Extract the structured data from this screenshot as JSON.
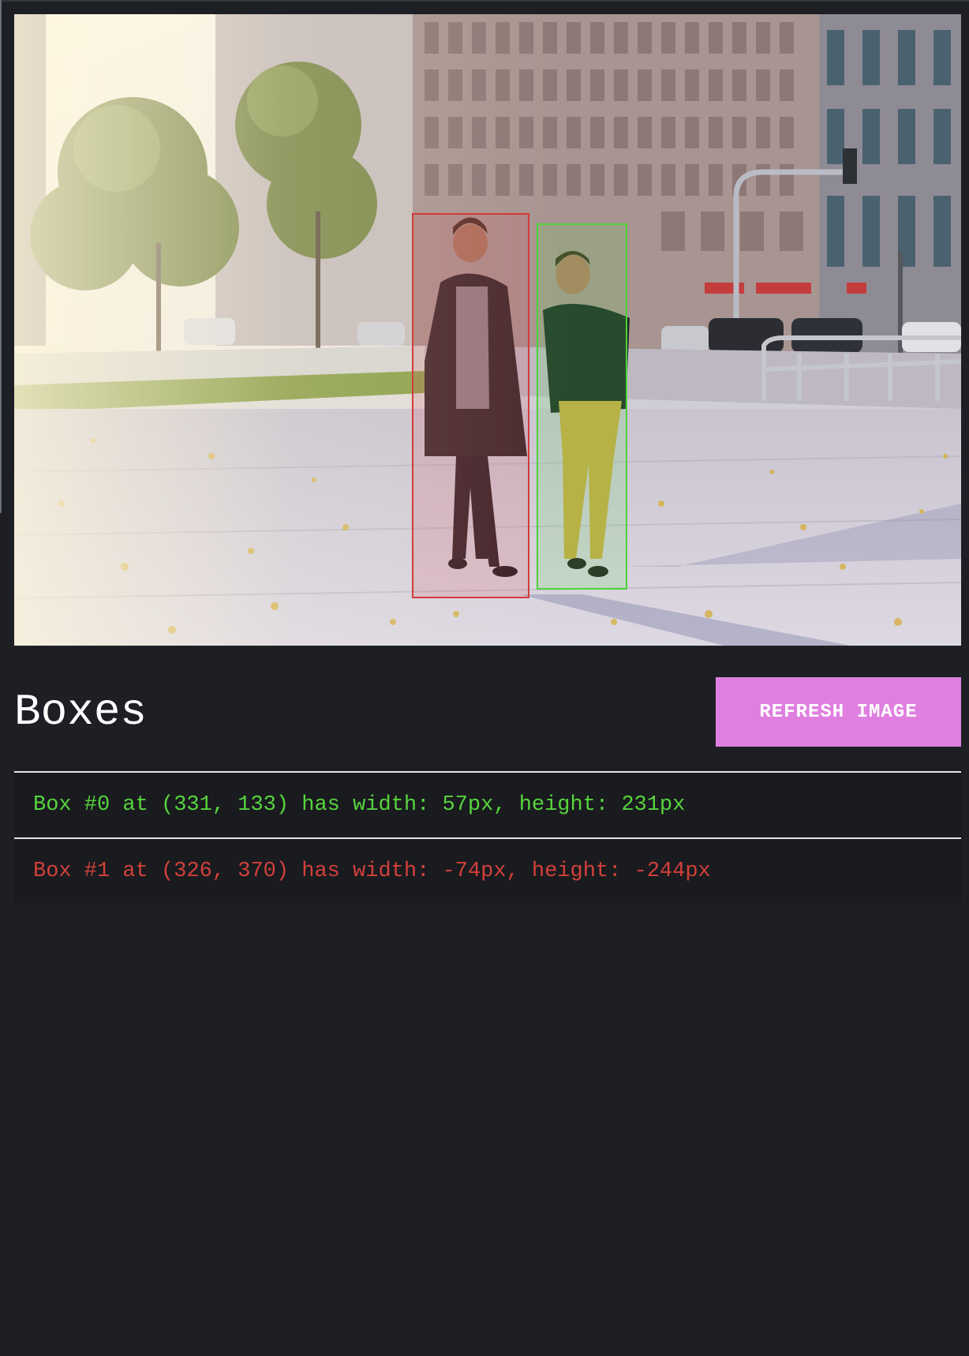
{
  "image": {
    "description_icon": "street-photo",
    "boxes": [
      {
        "color": "#d23b3b"
      },
      {
        "color": "#4fd13a"
      }
    ]
  },
  "header": {
    "title": "Boxes",
    "refresh_label": "REFRESH IMAGE"
  },
  "box_list": [
    {
      "text": "Box #0 at (331, 133) has width: 57px, height: 231px",
      "status_color": "#57d43d"
    },
    {
      "text": "Box #1 at (326, 370) has width: -74px, height: -244px",
      "status_color": "#d2403a"
    }
  ],
  "colors": {
    "background": "#1d1f24",
    "accent_button": "#e07fe0",
    "valid": "#57d43d",
    "invalid": "#d2403a"
  }
}
